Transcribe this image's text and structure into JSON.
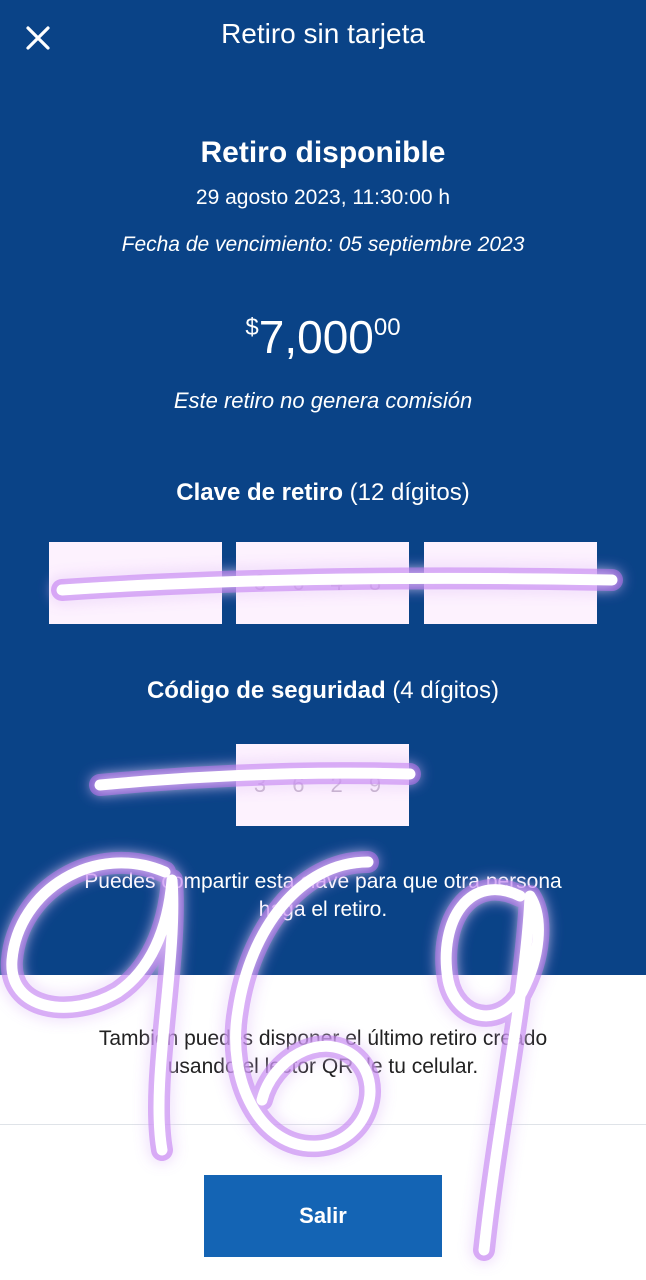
{
  "header": {
    "title": "Retiro sin tarjeta",
    "close_icon": "close-icon"
  },
  "withdrawal": {
    "title": "Retiro disponible",
    "datetime": "29 agosto 2023, 11:30:00 h",
    "expiry": "Fecha de vencimiento: 05 septiembre 2023",
    "currency": "$",
    "amount_main": "7,000",
    "amount_cents": "00",
    "fee_note": "Este retiro no genera comisión"
  },
  "withdrawal_key": {
    "label_bold": "Clave de retiro",
    "label_note": "(12 dígitos)",
    "groups": [
      "",
      "3 6 4 8",
      ""
    ]
  },
  "security_code": {
    "label_bold": "Código de seguridad",
    "label_note": "(4 dígitos)",
    "value": "3 6 2 9"
  },
  "share_note": "Puedes compartir esta clave para que otra persona haga el retiro.",
  "qr_note": "También puedes disponer el último retiro creado usando el lector QR de tu celular.",
  "actions": {
    "exit_label": "Salir"
  },
  "colors": {
    "header_bg": "#0a4387",
    "button_bg": "#1464b4",
    "mask_box": "#fdf2fe"
  }
}
